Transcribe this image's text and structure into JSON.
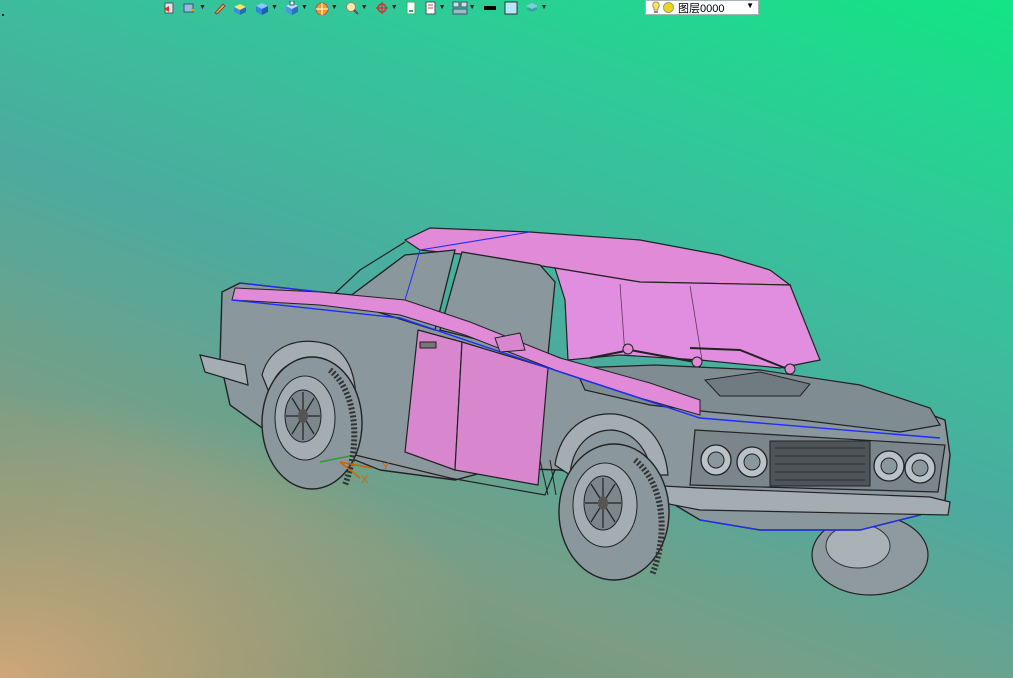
{
  "toolbar": {
    "tools": [
      {
        "icon": "undo-icon",
        "has_dropdown": false
      },
      {
        "icon": "select-filter-icon",
        "has_dropdown": true
      },
      {
        "icon": "pen-icon",
        "has_dropdown": false
      },
      {
        "icon": "box-yellow-icon",
        "has_dropdown": false
      },
      {
        "icon": "cube-icon",
        "has_dropdown": true
      },
      {
        "icon": "cube-view-icon",
        "has_dropdown": true
      },
      {
        "icon": "render-ball-icon",
        "has_dropdown": true
      },
      {
        "icon": "zoom-icon",
        "has_dropdown": true
      },
      {
        "icon": "snap-target-icon",
        "has_dropdown": true
      },
      {
        "icon": "page-icon",
        "has_dropdown": false
      },
      {
        "icon": "doc-icon",
        "has_dropdown": true
      },
      {
        "icon": "layout-icon",
        "has_dropdown": true
      },
      {
        "icon": "line-weight-icon",
        "has_dropdown": false
      },
      {
        "icon": "color-swatch-icon",
        "has_dropdown": false
      },
      {
        "icon": "layers-icon",
        "has_dropdown": true
      }
    ],
    "layer": {
      "name": "图层0000",
      "icons": [
        "lightbulb-icon",
        "sun-icon"
      ]
    }
  },
  "viewport": {
    "model": "car-3d-model",
    "axis_label_x": "X",
    "axis_label_y": "Y",
    "colors": {
      "body_gray": "#8a979d",
      "pink_panel": "#e08ad8",
      "edge_blue": "#1f2cff",
      "edge_dark": "#222222"
    }
  }
}
